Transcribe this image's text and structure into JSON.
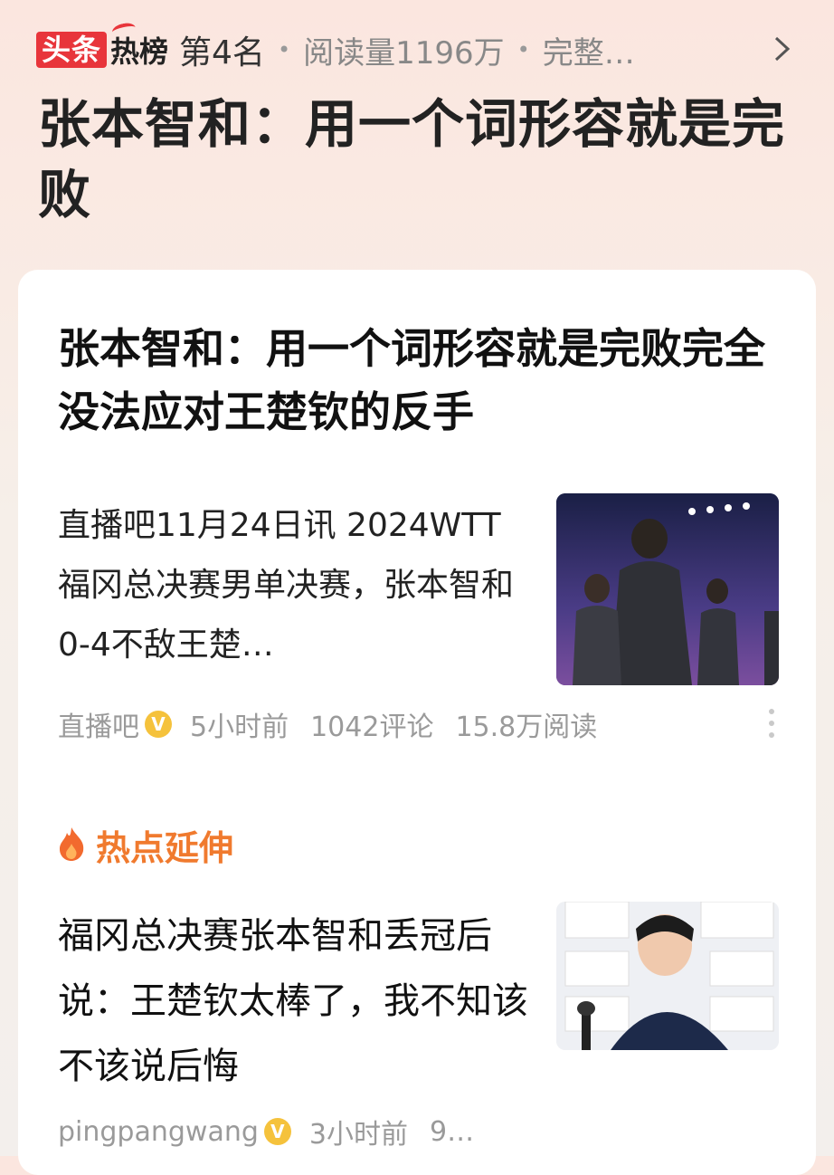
{
  "header": {
    "logo_toutiao": "头条",
    "logo_rebang": "热榜",
    "rank": "第4名",
    "reads": "阅读量1196万",
    "more": "完整…",
    "title": "张本智和：用一个词形容就是完败"
  },
  "article": {
    "title": "张本智和：用一个词形容就是完败完全没法应对王楚钦的反手",
    "summary": "直播吧11月24日讯 2024WTT福冈总决赛男单决赛，张本智和0-4不敌王楚…",
    "source": "直播吧",
    "time": "5小时前",
    "comments": "1042评论",
    "reads": "15.8万阅读"
  },
  "hot_extension": {
    "label": "热点延伸",
    "item": {
      "title": "福冈总决赛张本智和丢冠后说：王楚钦太棒了，我不知该不该说后悔",
      "source": "pingpangwang",
      "time": "3小时前",
      "extra": "9…"
    }
  },
  "colors": {
    "accent_red": "#e8353b",
    "hot_orange": "#f07a2e",
    "verified_yellow": "#f5c23c"
  },
  "icons": [
    "chevron-right-icon",
    "verified-icon",
    "more-vertical-icon",
    "flame-icon"
  ]
}
